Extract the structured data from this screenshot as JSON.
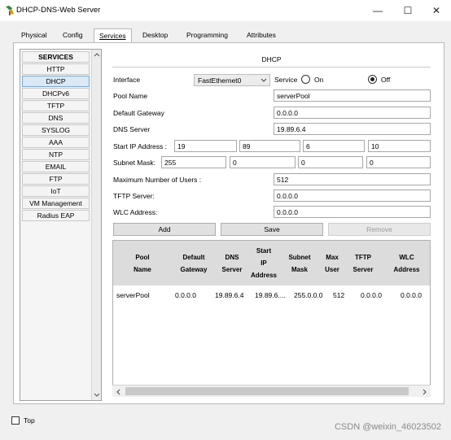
{
  "window": {
    "title": "DHCP-DNS-Web Server",
    "minimize": "—",
    "maximize": "☐",
    "close": "✕"
  },
  "tabs": [
    "Physical",
    "Config",
    "Services",
    "Desktop",
    "Programming",
    "Attributes"
  ],
  "services": {
    "header": "SERVICES",
    "items": [
      "HTTP",
      "DHCP",
      "DHCPv6",
      "TFTP",
      "DNS",
      "SYSLOG",
      "AAA",
      "NTP",
      "EMAIL",
      "FTP",
      "IoT",
      "VM Management",
      "Radius EAP"
    ],
    "selected": "DHCP"
  },
  "dhcp": {
    "section_title": "DHCP",
    "interface_label": "Interface",
    "interface_value": "FastEthernet0",
    "service_label": "Service",
    "on_label": "On",
    "off_label": "Off",
    "pool_name_label": "Pool Name",
    "pool_name_value": "serverPool",
    "gateway_label": "Default Gateway",
    "gateway_value": "0.0.0.0",
    "dns_label": "DNS Server",
    "dns_value": "19.89.6.4",
    "start_ip_label": "Start IP Address :",
    "start_ip": [
      "19",
      "89",
      "6",
      "10"
    ],
    "subnet_label": "Subnet Mask:",
    "subnet": [
      "255",
      "0",
      "0",
      "0"
    ],
    "max_users_label": "Maximum Number of Users :",
    "max_users_value": "512",
    "tftp_label": "TFTP Server:",
    "tftp_value": "0.0.0.0",
    "wlc_label": "WLC Address:",
    "wlc_value": "0.0.0.0",
    "add_label": "Add",
    "save_label": "Save",
    "remove_label": "Remove"
  },
  "table": {
    "headers": [
      "Pool\nName",
      "Default\nGateway",
      "DNS\nServer",
      "Start\nIP\nAddress",
      "Subnet\nMask",
      "Max\nUser",
      "TFTP\nServer",
      "WLC\nAddress"
    ],
    "rows": [
      [
        "serverPool",
        "0.0.0.0",
        "19.89.6.4",
        "19.89.6....",
        "255.0.0.0",
        "512",
        "0.0.0.0",
        "0.0.0.0"
      ]
    ]
  },
  "footer": {
    "top_label": "Top",
    "watermark": "CSDN @weixin_46023502"
  }
}
